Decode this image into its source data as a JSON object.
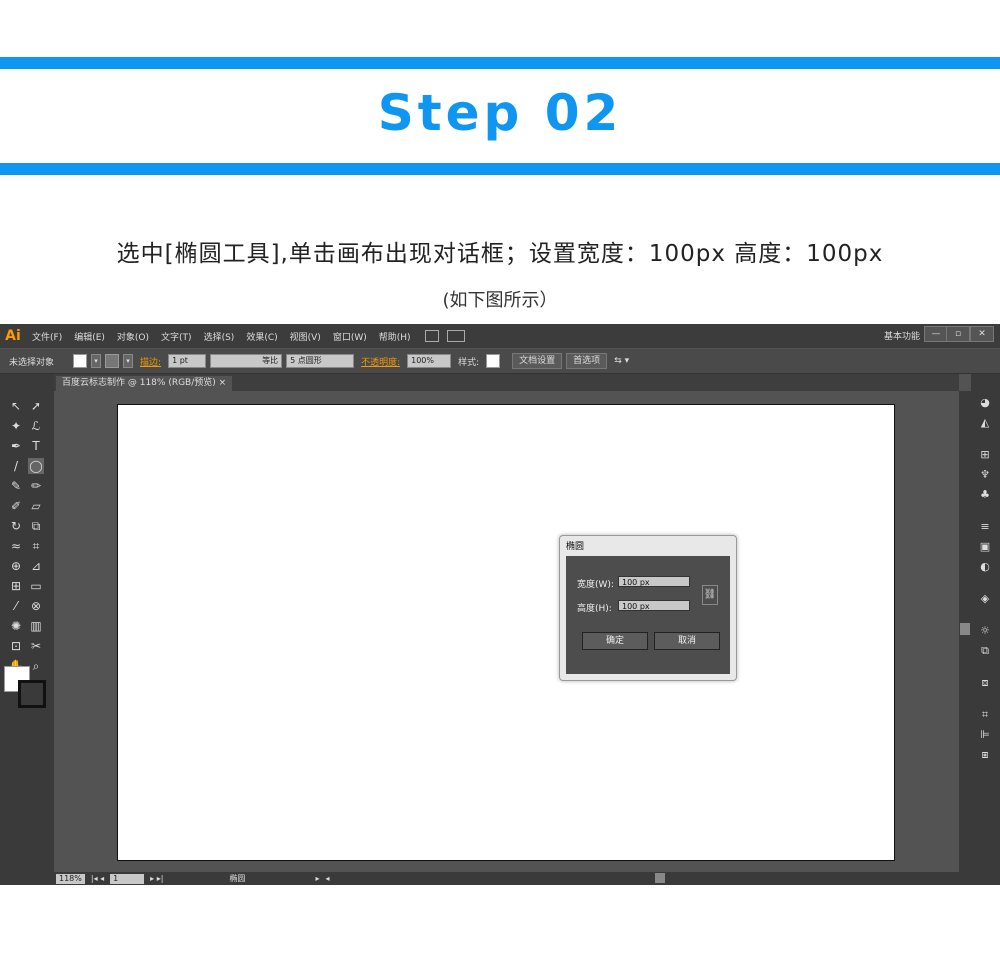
{
  "header": {
    "step_title": "Step 02",
    "instruction": "选中[椭圆工具],单击画布出现对话框；设置宽度：100px  高度：100px",
    "caption": "(如下图所示）",
    "accent_color": "#0f96f0"
  },
  "app": {
    "logo": "Ai",
    "menu": [
      "文件(F)",
      "编辑(E)",
      "对象(O)",
      "文字(T)",
      "选择(S)",
      "效果(C)",
      "视图(V)",
      "窗口(W)",
      "帮助(H)"
    ],
    "workspace": "基本功能",
    "window_buttons": [
      "—",
      "▫",
      "✕"
    ],
    "control_bar": {
      "selection": "未选择对象",
      "stroke_label": "描边:",
      "stroke_value": "1 pt",
      "stroke_style": "等比",
      "brush": "5 点圆形",
      "opacity_label": "不透明度:",
      "opacity_value": "100%",
      "style_label": "样式:",
      "doc_setup": "文档设置",
      "preferences": "首选项"
    },
    "document_tab": "百度云标志制作 @ 118% (RGB/预览)",
    "status": {
      "zoom": "118%",
      "page": "1",
      "tool": "椭圆"
    }
  },
  "dialog": {
    "title": "椭圆",
    "width_label": "宽度(W):",
    "width_value": "100 px",
    "height_label": "高度(H):",
    "height_value": "100 px",
    "ok": "确定",
    "cancel": "取消"
  }
}
